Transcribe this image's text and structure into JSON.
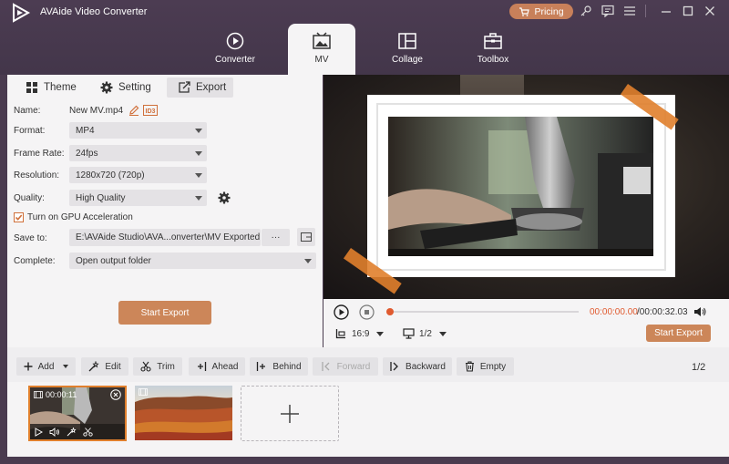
{
  "app": {
    "title": "AVAide Video Converter",
    "pricing_label": "Pricing"
  },
  "nav": {
    "tabs": [
      {
        "label": "Converter",
        "icon": "converter-icon"
      },
      {
        "label": "MV",
        "icon": "mv-icon",
        "active": true
      },
      {
        "label": "Collage",
        "icon": "collage-icon"
      },
      {
        "label": "Toolbox",
        "icon": "toolbox-icon"
      }
    ]
  },
  "subtabs": [
    {
      "label": "Theme",
      "icon": "theme-icon"
    },
    {
      "label": "Setting",
      "icon": "gear-icon"
    },
    {
      "label": "Export",
      "icon": "export-icon",
      "active": true
    }
  ],
  "export": {
    "name_label": "Name:",
    "name_value": "New MV.mp4",
    "format_label": "Format:",
    "format_value": "MP4",
    "framerate_label": "Frame Rate:",
    "framerate_value": "24fps",
    "resolution_label": "Resolution:",
    "resolution_value": "1280x720 (720p)",
    "quality_label": "Quality:",
    "quality_value": "High Quality",
    "gpu_label": "Turn on GPU Acceleration",
    "gpu_checked": true,
    "saveto_label": "Save to:",
    "saveto_value": "E:\\AVAide Studio\\AVA...onverter\\MV Exported",
    "browse_label": "···",
    "complete_label": "Complete:",
    "complete_value": "Open output folder",
    "start_export_label": "Start Export"
  },
  "player": {
    "time_current": "00:00:00.00",
    "time_total": "/00:00:32.03",
    "aspect_value": "16:9",
    "screen_value": "1/2",
    "start_export_label": "Start Export",
    "progress": 0.0
  },
  "toolbar": {
    "add": "Add",
    "edit": "Edit",
    "trim": "Trim",
    "ahead": "Ahead",
    "behind": "Behind",
    "forward": "Forward",
    "backward": "Backward",
    "empty": "Empty",
    "page": "1",
    "page_total": "/2"
  },
  "timeline": {
    "clip1_duration": "00:00:11"
  },
  "colors": {
    "accent": "#cc8659",
    "chrome": "#4a3b4f"
  }
}
